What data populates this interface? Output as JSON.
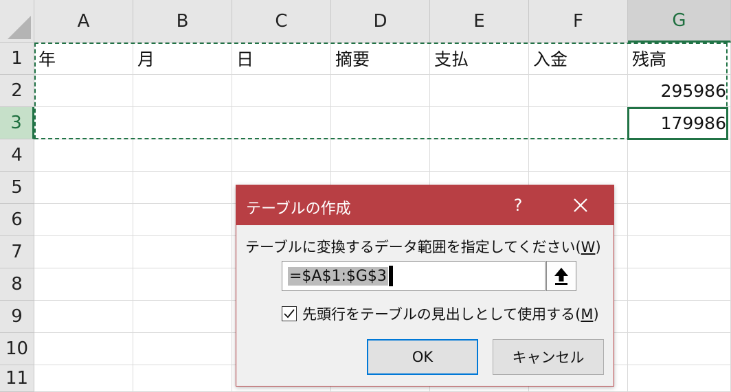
{
  "columns": [
    "A",
    "B",
    "C",
    "D",
    "E",
    "F",
    "G"
  ],
  "rows": [
    "1",
    "2",
    "3",
    "4",
    "5",
    "6",
    "7",
    "8",
    "9",
    "10",
    "11"
  ],
  "cells": {
    "A1": "年",
    "B1": "月",
    "C1": "日",
    "D1": "摘要",
    "E1": "支払",
    "F1": "入金",
    "G1": "残高",
    "G2": "295986",
    "G3": "179986"
  },
  "active_cell": "G3",
  "dialog": {
    "title": "テーブルの作成",
    "help_label": "?",
    "prompt_text": "テーブルに変換するデータ範囲を指定してください(",
    "prompt_accel": "W",
    "prompt_end": ")",
    "range_value": "=$A$1:$G$3",
    "header_checkbox_text": "先頭行をテーブルの見出しとして使用する(",
    "header_checkbox_accel": "M",
    "header_checkbox_end": ")",
    "header_checked": true,
    "ok_label": "OK",
    "cancel_label": "キャンセル"
  },
  "colors": {
    "dialog_accent": "#b83f44",
    "selection_green": "#217346",
    "ok_border": "#0078d7"
  }
}
